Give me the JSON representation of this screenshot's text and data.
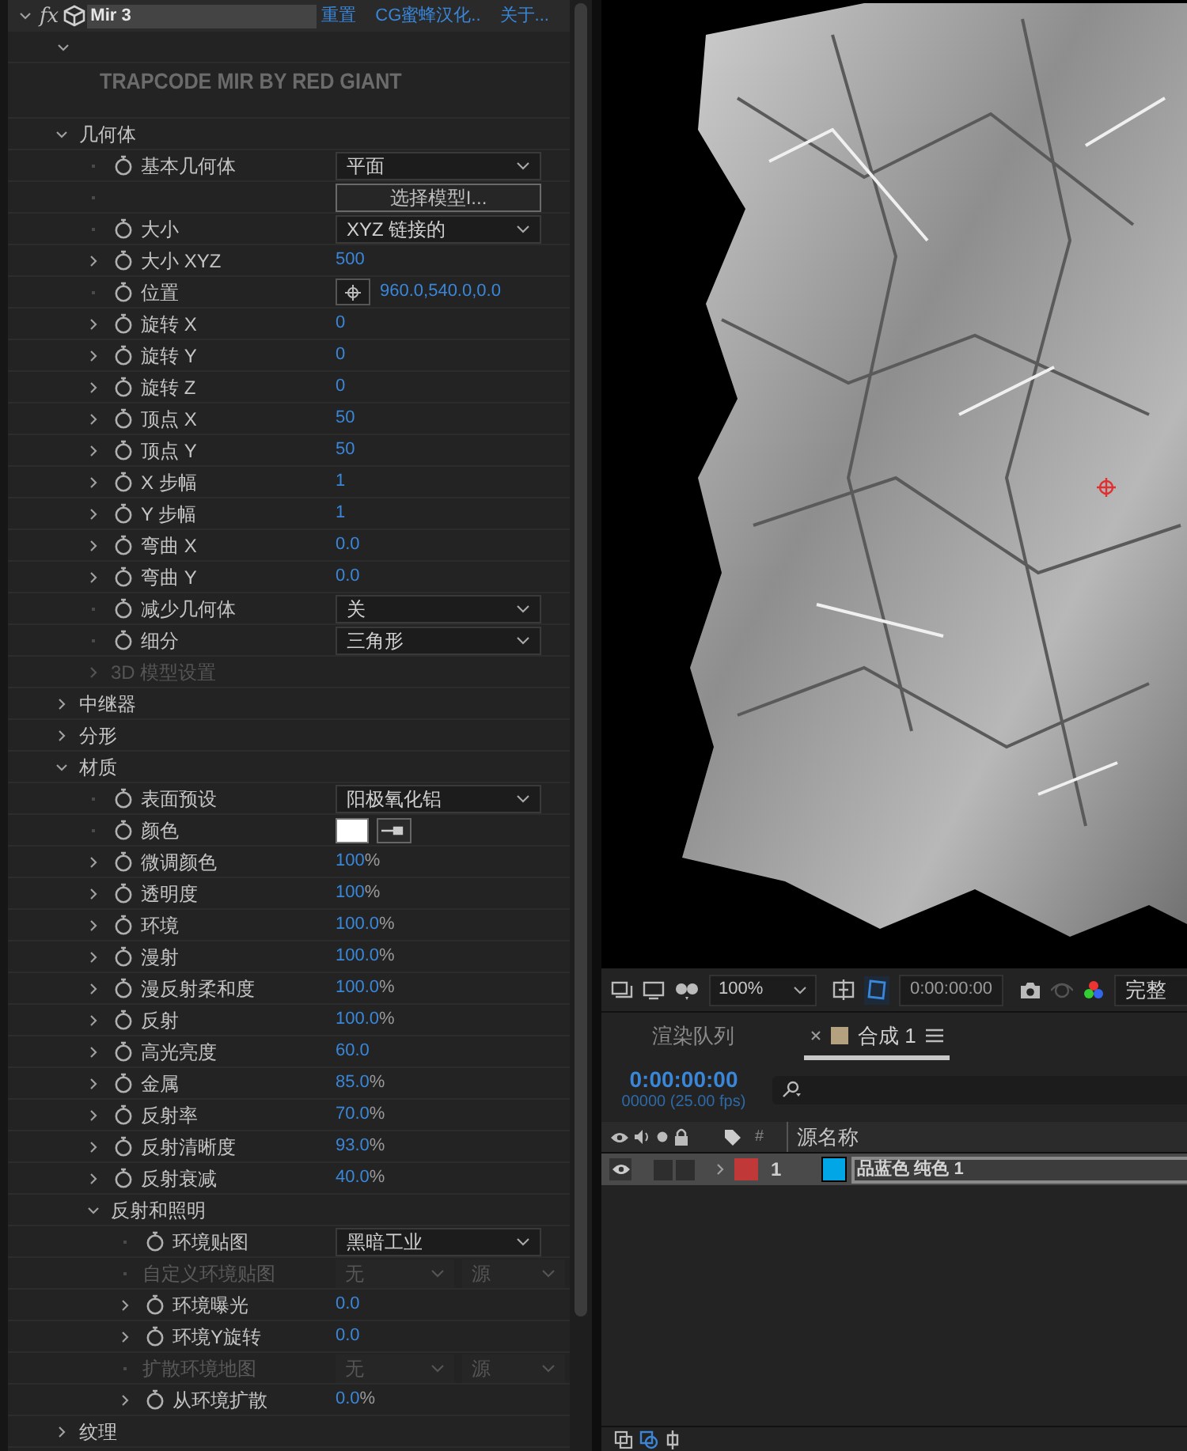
{
  "effect": {
    "expanded": true,
    "fx_label": "fx",
    "name": "Mir 3",
    "links": [
      "重置",
      "CG蜜蜂汉化..",
      "关于..."
    ],
    "logo_expanded": true,
    "logo": "TRAPCODE MIR BY RED GIANT",
    "properties": [
      {
        "kind": "group",
        "label": "几何体",
        "expanded": true,
        "disabled": false,
        "children": [
          {
            "kind": "dropdown",
            "label": "基本几何体",
            "value": "平面",
            "expandable": false
          },
          {
            "kind": "button",
            "value": "选择模型I...",
            "expandable": false
          },
          {
            "kind": "dropdown",
            "label": "大小",
            "value": "XYZ 链接的",
            "expandable": false
          },
          {
            "kind": "number",
            "label": "大小 XYZ",
            "value": "500",
            "expandable": true
          },
          {
            "kind": "point",
            "label": "位置",
            "value": "960.0,540.0,0.0",
            "expandable": false
          },
          {
            "kind": "number",
            "label": "旋转 X",
            "value": "0",
            "expandable": true
          },
          {
            "kind": "number",
            "label": "旋转 Y",
            "value": "0",
            "expandable": true
          },
          {
            "kind": "number",
            "label": "旋转 Z",
            "value": "0",
            "expandable": true
          },
          {
            "kind": "number",
            "label": "顶点 X",
            "value": "50",
            "expandable": true
          },
          {
            "kind": "number",
            "label": "顶点 Y",
            "value": "50",
            "expandable": true
          },
          {
            "kind": "number",
            "label": "X 步幅",
            "value": "1",
            "expandable": true
          },
          {
            "kind": "number",
            "label": "Y 步幅",
            "value": "1",
            "expandable": true
          },
          {
            "kind": "number",
            "label": "弯曲 X",
            "value": "0.0",
            "expandable": true
          },
          {
            "kind": "number",
            "label": "弯曲 Y",
            "value": "0.0",
            "expandable": true
          },
          {
            "kind": "dropdown",
            "label": "减少几何体",
            "value": "关",
            "expandable": false
          },
          {
            "kind": "dropdown",
            "label": "细分",
            "value": "三角形",
            "expandable": false
          },
          {
            "kind": "group",
            "label": "3D 模型设置",
            "expanded": false,
            "disabled": true
          }
        ]
      },
      {
        "kind": "group",
        "label": "中继器",
        "expanded": false,
        "disabled": false
      },
      {
        "kind": "group",
        "label": "分形",
        "expanded": false,
        "disabled": false
      },
      {
        "kind": "group",
        "label": "材质",
        "expanded": true,
        "disabled": false,
        "children": [
          {
            "kind": "dropdown",
            "label": "表面预设",
            "value": "阳极氧化铝",
            "expandable": false
          },
          {
            "kind": "color",
            "label": "颜色",
            "color": "#ffffff",
            "expandable": false
          },
          {
            "kind": "number",
            "label": "微调颜色",
            "value": "100",
            "unit": "%",
            "expandable": true
          },
          {
            "kind": "number",
            "label": "透明度",
            "value": "100",
            "unit": "%",
            "expandable": true
          },
          {
            "kind": "number",
            "label": "环境",
            "value": "100.0",
            "unit": "%",
            "expandable": true
          },
          {
            "kind": "number",
            "label": "漫射",
            "value": "100.0",
            "unit": "%",
            "expandable": true
          },
          {
            "kind": "number",
            "label": "漫反射柔和度",
            "value": "100.0",
            "unit": "%",
            "expandable": true
          },
          {
            "kind": "number",
            "label": "反射",
            "value": "100.0",
            "unit": "%",
            "expandable": true
          },
          {
            "kind": "number",
            "label": "高光亮度",
            "value": "60.0",
            "expandable": true
          },
          {
            "kind": "number",
            "label": "金属",
            "value": "85.0",
            "unit": "%",
            "expandable": true
          },
          {
            "kind": "number",
            "label": "反射率",
            "value": "70.0",
            "unit": "%",
            "expandable": true
          },
          {
            "kind": "number",
            "label": "反射清晰度",
            "value": "93.0",
            "unit": "%",
            "expandable": true
          },
          {
            "kind": "number",
            "label": "反射衰减",
            "value": "40.0",
            "unit": "%",
            "expandable": true
          },
          {
            "kind": "group",
            "label": "反射和照明",
            "expanded": true,
            "disabled": false,
            "children": [
              {
                "kind": "dropdown",
                "label": "环境贴图",
                "value": "黑暗工业",
                "expandable": false
              },
              {
                "kind": "layer",
                "label": "自定义环境贴图",
                "values": [
                  "无",
                  "源"
                ],
                "expandable": false
              },
              {
                "kind": "number",
                "label": "环境曝光",
                "value": "0.0",
                "expandable": true
              },
              {
                "kind": "number",
                "label": "环境Y旋转",
                "value": "0.0",
                "expandable": true
              },
              {
                "kind": "layer",
                "label": "扩散环境地图",
                "values": [
                  "无",
                  "源"
                ],
                "expandable": false
              },
              {
                "kind": "number",
                "label": "从环境扩散",
                "value": "0.0",
                "unit": "%",
                "expandable": true
              }
            ]
          }
        ]
      },
      {
        "kind": "group",
        "label": "纹理",
        "expanded": false,
        "disabled": false
      }
    ]
  },
  "viewer": {
    "zoom": "100%",
    "time": "0:00:00:00",
    "resolution": "完整"
  },
  "timeline": {
    "tabs": [
      {
        "label": "渲染队列",
        "selected": false,
        "closable": false
      },
      {
        "label": "合成 1",
        "selected": true,
        "closable": true
      }
    ],
    "time": "0:00:00:00",
    "fps": "00000 (25.00 fps)",
    "columns": [
      "#",
      "源名称"
    ],
    "layers": [
      {
        "number": "1",
        "name": "品蓝色 纯色 1",
        "selected": true,
        "visible": true,
        "color": "#c03838",
        "solid": {
          "color": "#00a6e6"
        }
      }
    ]
  }
}
